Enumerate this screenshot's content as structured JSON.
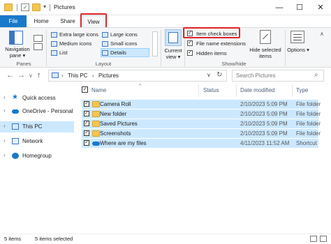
{
  "window": {
    "title": "Pictures",
    "minimize_glyph": "—",
    "maximize_glyph": "☐",
    "close_glyph": "✕"
  },
  "tabs": [
    {
      "label": "File"
    },
    {
      "label": "Home"
    },
    {
      "label": "Share"
    },
    {
      "label": "View"
    }
  ],
  "ribbon": {
    "panes": {
      "navigation_pane_label": "Navigation pane ▾",
      "group_label": "Panes"
    },
    "layout": {
      "options": [
        "Extra large icons",
        "Large icons",
        "Medium icons",
        "Small icons",
        "List",
        "Details"
      ],
      "group_label": "Layout"
    },
    "current_view": {
      "label": "Current view ▾"
    },
    "show_hide": {
      "item_check_boxes": "Item check boxes",
      "file_name_extensions": "File name extensions",
      "hidden_items": "Hidden items",
      "hide_selected_items": "Hide selected items",
      "group_label": "Show/hide",
      "checkmark": "✓"
    },
    "options_label": "Options ▾"
  },
  "address": {
    "back_glyph": "←",
    "forward_glyph": "→",
    "dropdown_glyph": "∨",
    "up_glyph": "↑",
    "separator": "›",
    "crumbs": [
      "This PC",
      "Pictures"
    ],
    "refresh_glyph": "↻",
    "search_placeholder": "Search Pictures",
    "search_glyph": "⌕"
  },
  "nav_pane": {
    "chevron": "›",
    "items": [
      {
        "label": "Quick access"
      },
      {
        "label": "OneDrive - Personal"
      },
      {
        "label": "This PC"
      },
      {
        "label": "Network"
      },
      {
        "label": "Homegroup"
      }
    ]
  },
  "file_list": {
    "columns": [
      "Name",
      "Status",
      "Date modified",
      "Type"
    ],
    "sort_glyph": "^",
    "header_check": "✓",
    "rows": [
      {
        "name": "Camera Roll",
        "date": "2/10/2023 5:09 PM",
        "type": "File folder",
        "icon": "folder-icon"
      },
      {
        "name": "New folder",
        "date": "2/10/2023 5:09 PM",
        "type": "File folder",
        "icon": "folder-icon"
      },
      {
        "name": "Saved Pictures",
        "date": "2/10/2023 5:09 PM",
        "type": "File folder",
        "icon": "folder-icon"
      },
      {
        "name": "Screenshots",
        "date": "2/10/2023 5:09 PM",
        "type": "File folder",
        "icon": "folder-icon"
      },
      {
        "name": "Where are my files",
        "date": "4/11/2023 11:52 AM",
        "type": "Shortcut",
        "icon": "shortcut-cloud-icon"
      }
    ]
  },
  "status_bar": {
    "item_count": "5 items",
    "selected_count": "5 items selected"
  },
  "colors": {
    "accent": "#1979ca",
    "selection": "#cce8ff",
    "highlight_box": "#e0232b"
  }
}
